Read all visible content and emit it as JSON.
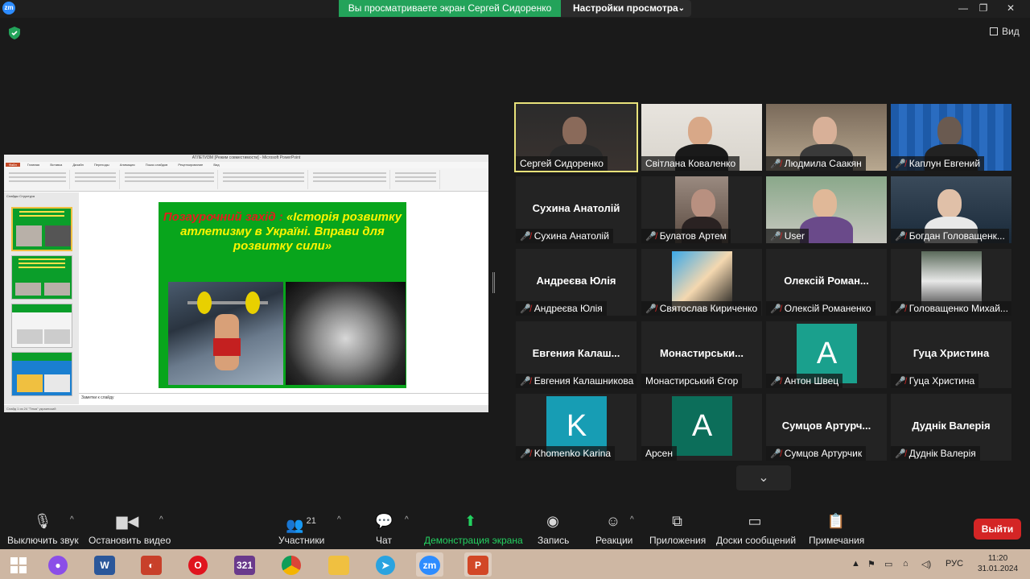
{
  "titlebar": {
    "app_logo": "zm",
    "share_banner": "Вы просматриваете экран Сергей Сидоренко",
    "view_settings": "Настройки просмотра",
    "view_button": "Вид"
  },
  "shared_screen": {
    "window_title": "АТЛЕТИЗМ [Режим совместимости] - Microsoft PowerPoint",
    "ribbon_tabs": [
      "Файл",
      "Главная",
      "Вставка",
      "Дизайн",
      "Переходы",
      "Анимация",
      "Показ слайдов",
      "Рецензирование",
      "Вид"
    ],
    "panel_tabs": "Слайды   Структура",
    "slide": {
      "heading_red": "Позаурочний захід :",
      "heading_yellow": "«Історія розвитку атлетизму в Україні. Вправи для розвитку сили»"
    },
    "notes_placeholder": "Заметки к слайду",
    "status_text": "Слайд 1 из 24   \"Тема\"   украинский"
  },
  "gallery": {
    "tiles": [
      {
        "name": "Сергей Сидоренко",
        "muted": false,
        "type": "video",
        "speaking": true
      },
      {
        "name": "Світлана Коваленко",
        "muted": false,
        "type": "video"
      },
      {
        "name": "Людмила Саакян",
        "muted": true,
        "type": "video"
      },
      {
        "name": "Каплун Евгений",
        "muted": true,
        "type": "video"
      },
      {
        "name": "Сухина Анатолій",
        "bigname": "Сухина Анатолій",
        "muted": true,
        "type": "name"
      },
      {
        "name": "Булатов Артем",
        "muted": true,
        "type": "video"
      },
      {
        "name": "User",
        "muted": true,
        "type": "video"
      },
      {
        "name": "Богдан Головащенк...",
        "muted": true,
        "type": "video"
      },
      {
        "name": "Андреєва Юлія",
        "bigname": "Андреєва Юлія",
        "muted": true,
        "type": "name"
      },
      {
        "name": "Святослав Кириченко",
        "muted": true,
        "type": "avatar-img"
      },
      {
        "name": "Олексій Романенко",
        "bigname": "Олексій Роман...",
        "muted": true,
        "type": "name"
      },
      {
        "name": "Головащенко Михай...",
        "muted": true,
        "type": "avatar-img"
      },
      {
        "name": "Евгения Калашникова",
        "bigname": "Евгения  Калаш...",
        "muted": true,
        "type": "name"
      },
      {
        "name": "Монастирський Єгор",
        "bigname": "Монастирськи...",
        "muted": false,
        "type": "name"
      },
      {
        "name": "Антон Швец",
        "muted": true,
        "type": "letter",
        "letter": "A",
        "color": "#1aa08d"
      },
      {
        "name": "Гуца Христина",
        "bigname": "Гуца Христина",
        "muted": true,
        "type": "name"
      },
      {
        "name": "Khomenko Karina",
        "muted": true,
        "type": "letter",
        "letter": "K",
        "color": "#179db4"
      },
      {
        "name": "Арсен",
        "muted": false,
        "type": "letter",
        "letter": "A",
        "color": "#0c6e5a"
      },
      {
        "name": "Сумцов Артурчик",
        "bigname": "Сумцов  Артурч...",
        "muted": true,
        "type": "name"
      },
      {
        "name": "Дуднік Валерія",
        "bigname": "Дуднік Валерія",
        "muted": true,
        "type": "name"
      }
    ]
  },
  "toolbar": {
    "mute": "Выключить звук",
    "video": "Остановить видео",
    "participants": "Участники",
    "participants_count": "21",
    "chat": "Чат",
    "share": "Демонстрация экрана",
    "record": "Запись",
    "reactions": "Реакции",
    "apps": "Приложения",
    "whiteboards": "Доски сообщений",
    "notes": "Примечания",
    "leave": "Выйти"
  },
  "taskbar": {
    "apps": [
      "windows-start",
      "alice",
      "word",
      "ccleaner",
      "opera",
      "calendar-321",
      "chrome",
      "explorer",
      "telegram",
      "zoom",
      "powerpoint"
    ],
    "zoom_label": "zm",
    "word_label": "W",
    "cal_label": "321",
    "lang": "РУС",
    "time": "11:20",
    "date": "31.01.2024"
  },
  "colors": {
    "banner_green": "#23a35a",
    "share_green": "#23d160",
    "leave_red": "#d42525",
    "speaking_outline": "#e8e27a",
    "muted_red": "#e02828"
  }
}
